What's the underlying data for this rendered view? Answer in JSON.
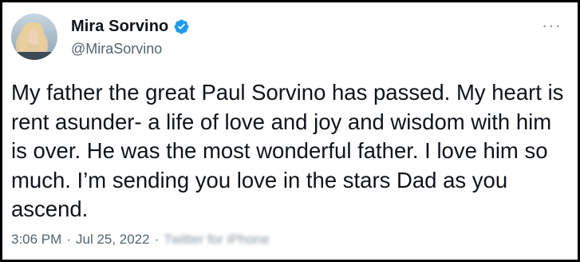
{
  "tweet": {
    "author": {
      "display_name": "Mira Sorvino",
      "handle": "@MiraSorvino",
      "verified": true
    },
    "more_icon": "more-icon",
    "text": "My father the great Paul Sorvino has passed. My heart is rent asunder- a life of love and joy and wisdom with him is over. He was the most wonderful father. I love him so much. I’m sending you love in the stars Dad as you ascend.",
    "time": "3:06 PM",
    "separator": "·",
    "date": "Jul 25, 2022",
    "source": "Twitter for iPhone"
  },
  "colors": {
    "text": "#0f1419",
    "secondary": "#536471",
    "verified_blue": "#1d9bf0",
    "background": "#ffffff"
  }
}
